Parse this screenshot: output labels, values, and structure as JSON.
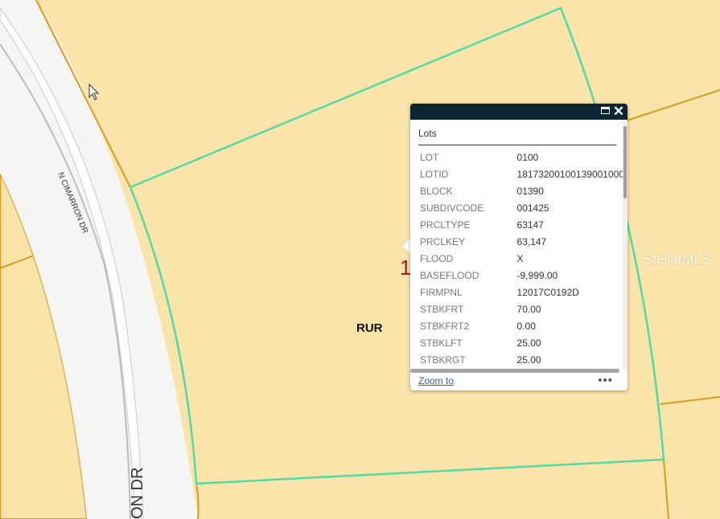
{
  "map": {
    "road_label_upper": "N CIMARRON DR",
    "road_label_lower": "ON DR",
    "zone_label": "RUR",
    "hidden_parcel_digit": "1",
    "watermark": "StellarMLS",
    "colors": {
      "parcel_fill": "#fbe4aa",
      "parcel_border": "#d99a1e",
      "selected_border": "#4fdba6",
      "road_fill": "#f5f5f5"
    }
  },
  "popup": {
    "title": "Lots",
    "attributes": [
      {
        "key": "LOT",
        "value": "0100"
      },
      {
        "key": "LOTID",
        "value": "18173200100139001000"
      },
      {
        "key": "BLOCK",
        "value": "01390"
      },
      {
        "key": "SUBDIVCODE",
        "value": "001425"
      },
      {
        "key": "PRCLTYPE",
        "value": "63147"
      },
      {
        "key": "PRCLKEY",
        "value": "63,147"
      },
      {
        "key": "FLOOD",
        "value": "X"
      },
      {
        "key": "BASEFLOOD",
        "value": "-9,999.00"
      },
      {
        "key": "FIRMPNL",
        "value": "12017C0192D"
      },
      {
        "key": "STBKFRT",
        "value": "70.00"
      },
      {
        "key": "STBKFRT2",
        "value": "0.00"
      },
      {
        "key": "STBKLFT",
        "value": "25.00"
      },
      {
        "key": "STBKRGT",
        "value": "25.00"
      }
    ],
    "zoom_label": "Zoom to",
    "more_label": "•••",
    "maximize_icon": "maximize-icon",
    "close_icon": "close-icon",
    "close_glyph": "✕"
  }
}
